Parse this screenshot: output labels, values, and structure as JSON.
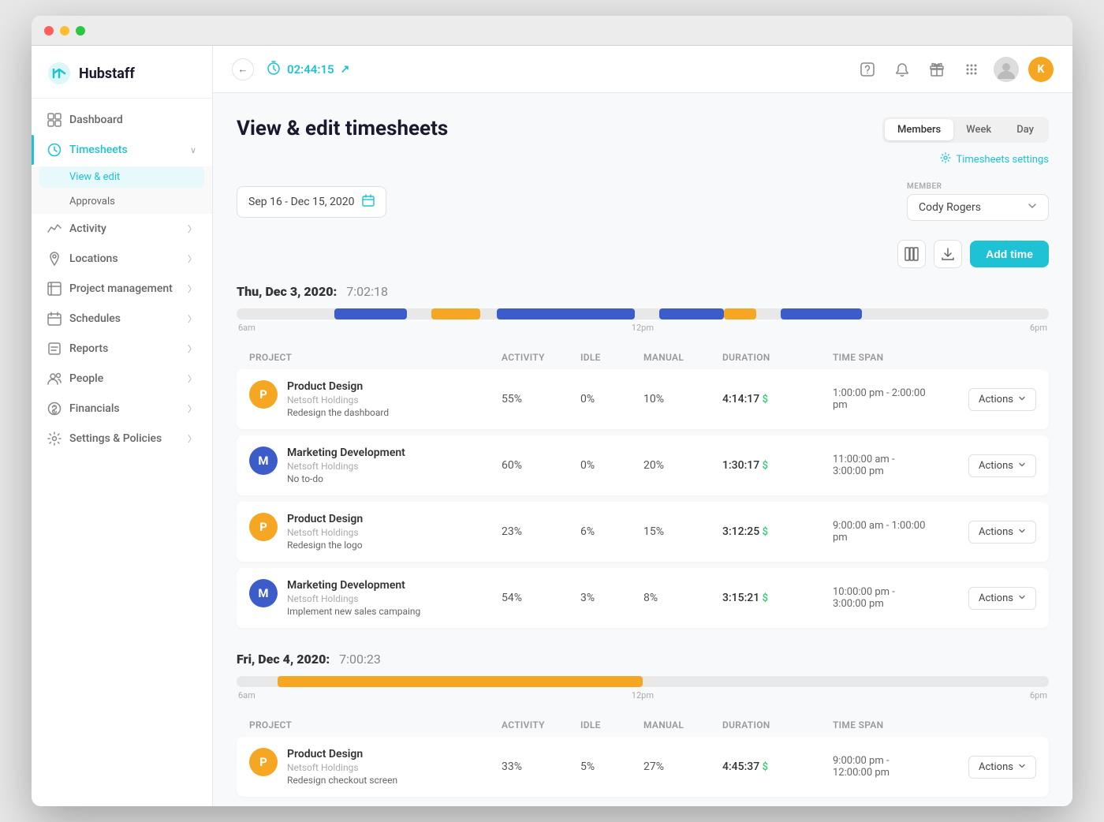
{
  "window": {
    "title": "Hubstaff"
  },
  "sidebar": {
    "logo": "Hubstaff",
    "nav_items": [
      {
        "id": "dashboard",
        "label": "Dashboard",
        "icon": "⊞",
        "active": false
      },
      {
        "id": "timesheets",
        "label": "Timesheets",
        "icon": "◷",
        "active": true,
        "expanded": true
      },
      {
        "id": "activity",
        "label": "Activity",
        "icon": "📈",
        "active": false
      },
      {
        "id": "locations",
        "label": "Locations",
        "icon": "📍",
        "active": false
      },
      {
        "id": "project-management",
        "label": "Project management",
        "icon": "▦",
        "active": false
      },
      {
        "id": "schedules",
        "label": "Schedules",
        "icon": "▤",
        "active": false
      },
      {
        "id": "reports",
        "label": "Reports",
        "icon": "📊",
        "active": false
      },
      {
        "id": "people",
        "label": "People",
        "icon": "👥",
        "active": false
      },
      {
        "id": "financials",
        "label": "Financials",
        "icon": "⊙",
        "active": false
      },
      {
        "id": "settings-policies",
        "label": "Settings & Policies",
        "icon": "⚙",
        "active": false
      }
    ],
    "sub_items": [
      {
        "id": "view-edit",
        "label": "View & edit",
        "active": true
      },
      {
        "id": "approvals",
        "label": "Approvals",
        "active": false
      }
    ]
  },
  "topbar": {
    "back_button": "←",
    "timer": "02:44:15",
    "timer_expand": "↗",
    "avatar_initial": "K"
  },
  "page": {
    "title": "View & edit timesheets",
    "view_tabs": [
      {
        "label": "Members",
        "active": false
      },
      {
        "label": "Week",
        "active": false
      },
      {
        "label": "Day",
        "active": false
      }
    ],
    "settings_link": "Timesheets settings",
    "date_range": "Sep 16 - Dec 15, 2020",
    "member_label": "MEMBER",
    "member_name": "Cody Rogers",
    "add_time_label": "Add time"
  },
  "day1": {
    "label": "Thu, Dec 3, 2020:",
    "duration": "7:02:18",
    "time_labels": [
      "6am",
      "12pm",
      "6pm"
    ],
    "segments": [
      {
        "left": "12%",
        "width": "9%",
        "color": "#3b5cc9"
      },
      {
        "left": "24%",
        "width": "6%",
        "color": "#f5a623"
      },
      {
        "left": "32%",
        "width": "17%",
        "color": "#3b5cc9"
      },
      {
        "left": "52%",
        "width": "8%",
        "color": "#3b5cc9"
      },
      {
        "left": "60%",
        "width": "4%",
        "color": "#f5a623"
      },
      {
        "left": "67%",
        "width": "10%",
        "color": "#3b5cc9"
      }
    ],
    "headers": [
      "Project",
      "Activity",
      "Idle",
      "Manual",
      "Duration",
      "Time span",
      ""
    ],
    "rows": [
      {
        "avatar_letter": "P",
        "avatar_color": "orange",
        "project": "Product Design",
        "company": "Netsoft Holdings",
        "task": "Redesign the dashboard",
        "activity": "55%",
        "idle": "0%",
        "manual": "10%",
        "duration": "4:14:17",
        "duration_dollar": "$",
        "timespan": "1:00:00 pm - 2:00:00 pm",
        "actions": "Actions"
      },
      {
        "avatar_letter": "M",
        "avatar_color": "blue",
        "project": "Marketing Development",
        "company": "Netsoft Holdings",
        "task": "No to-do",
        "activity": "60%",
        "idle": "0%",
        "manual": "20%",
        "duration": "1:30:17",
        "duration_dollar": "$",
        "timespan": "11:00:00 am - 3:00:00 pm",
        "actions": "Actions"
      },
      {
        "avatar_letter": "P",
        "avatar_color": "orange",
        "project": "Product Design",
        "company": "Netsoft Holdings",
        "task": "Redesign the logo",
        "activity": "23%",
        "idle": "6%",
        "manual": "15%",
        "duration": "3:12:25",
        "duration_dollar": "$",
        "timespan": "9:00:00 am - 1:00:00 pm",
        "actions": "Actions"
      },
      {
        "avatar_letter": "M",
        "avatar_color": "blue",
        "project": "Marketing Development",
        "company": "Netsoft Holdings",
        "task": "Implement new sales campaing",
        "activity": "54%",
        "idle": "3%",
        "manual": "8%",
        "duration": "3:15:21",
        "duration_dollar": "$",
        "timespan": "10:00:00 pm - 3:00:00 pm",
        "actions": "Actions"
      }
    ]
  },
  "day2": {
    "label": "Fri, Dec 4, 2020:",
    "duration": "7:00:23",
    "time_labels": [
      "6am",
      "12pm",
      "6pm"
    ],
    "segments": [
      {
        "left": "5%",
        "width": "45%",
        "color": "#f5a623"
      }
    ],
    "headers": [
      "Project",
      "Activity",
      "Idle",
      "Manual",
      "Duration",
      "Time span",
      ""
    ],
    "rows": [
      {
        "avatar_letter": "P",
        "avatar_color": "orange",
        "project": "Product Design",
        "company": "Netsoft Holdings",
        "task": "Redesign checkout screen",
        "activity": "33%",
        "idle": "5%",
        "manual": "27%",
        "duration": "4:45:37",
        "duration_dollar": "$",
        "timespan": "9:00:00 pm - 12:00:00 pm",
        "actions": "Actions"
      }
    ]
  },
  "icons": {
    "back": "←",
    "calendar": "📅",
    "columns": "⊞",
    "download": "⬇",
    "chevron_down": "∨",
    "gear": "⚙",
    "question": "?",
    "bell": "🔔",
    "gift": "🎁",
    "grid": "⠿",
    "external": "↗"
  }
}
